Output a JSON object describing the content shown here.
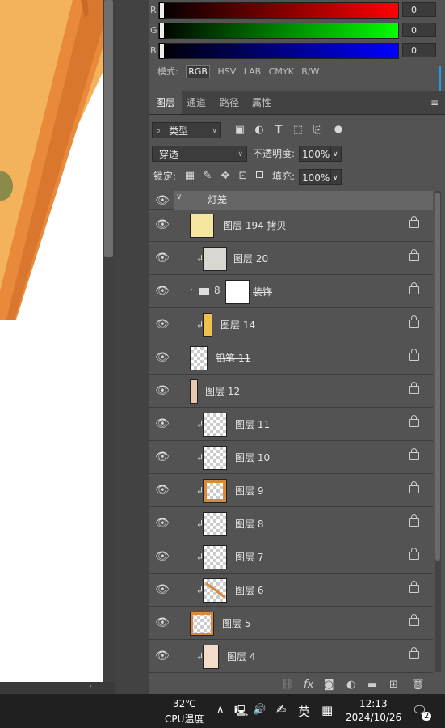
{
  "color_panel": {
    "channels": [
      {
        "label": "R",
        "value": "0",
        "color": "#ff0000"
      },
      {
        "label": "G",
        "value": "0",
        "color": "#00ff00"
      },
      {
        "label": "B",
        "value": "0",
        "color": "#0000ff"
      }
    ],
    "mode_label": "模式:",
    "modes": [
      "RGB",
      "HSV",
      "LAB",
      "CMYK",
      "B/W"
    ],
    "selected_mode": "RGB"
  },
  "tabs": [
    {
      "label": "图层",
      "active": true
    },
    {
      "label": "通道",
      "active": false
    },
    {
      "label": "路径",
      "active": false
    },
    {
      "label": "属性",
      "active": false
    }
  ],
  "filter": {
    "kind_label": "类型",
    "icons": [
      "image-filter-icon",
      "adjustment-filter-icon",
      "text-filter-icon",
      "shape-filter-icon",
      "smart-object-filter-icon",
      "toggle-filter-icon"
    ]
  },
  "blend": {
    "mode": "穿透",
    "opacity_label": "不透明度:",
    "opacity": "100%"
  },
  "lock": {
    "label": "锁定:",
    "fill_label": "填充:",
    "fill": "100%"
  },
  "layers": [
    {
      "name": "灯笼",
      "type": "group-open"
    },
    {
      "name": "图层 194 拷贝",
      "type": "layer",
      "clip": false,
      "thumb": "yellow"
    },
    {
      "name": "图层 20",
      "type": "layer",
      "clip": true,
      "thumb": "gray"
    },
    {
      "name": "装饰",
      "type": "group-closed",
      "clip": false,
      "thumb": "mask"
    },
    {
      "name": "图层 14",
      "type": "layer",
      "clip": true,
      "thumb": "yellow-strip"
    },
    {
      "name": "铅笔 11",
      "type": "layer",
      "clip": false,
      "thumb": "empty"
    },
    {
      "name": "图层 12",
      "type": "layer",
      "clip": false,
      "thumb": "red-strip"
    },
    {
      "name": "图层 11",
      "type": "layer",
      "clip": true,
      "thumb": "empty"
    },
    {
      "name": "图层 10",
      "type": "layer",
      "clip": true,
      "thumb": "empty"
    },
    {
      "name": "图层 9",
      "type": "layer",
      "clip": true,
      "thumb": "orange-frame"
    },
    {
      "name": "图层 8",
      "type": "layer",
      "clip": true,
      "thumb": "empty"
    },
    {
      "name": "图层 7",
      "type": "layer",
      "clip": true,
      "thumb": "empty"
    },
    {
      "name": "图层 6",
      "type": "layer",
      "clip": true,
      "thumb": "orange-line"
    },
    {
      "name": "图层 5",
      "type": "layer",
      "clip": false,
      "thumb": "orange-frame"
    },
    {
      "name": "图层 4",
      "type": "layer",
      "clip": true,
      "thumb": "peach"
    }
  ],
  "bottom_tools": [
    "link-layers-icon",
    "fx",
    "add-mask-icon",
    "adjustment-layer-icon",
    "new-group-icon",
    "new-layer-icon",
    "delete-icon"
  ],
  "taskbar": {
    "temp": "32℃",
    "temp_label": "CPU温度",
    "ime": "英",
    "time": "12:13",
    "date": "2024/10/26",
    "notifications": "2"
  }
}
